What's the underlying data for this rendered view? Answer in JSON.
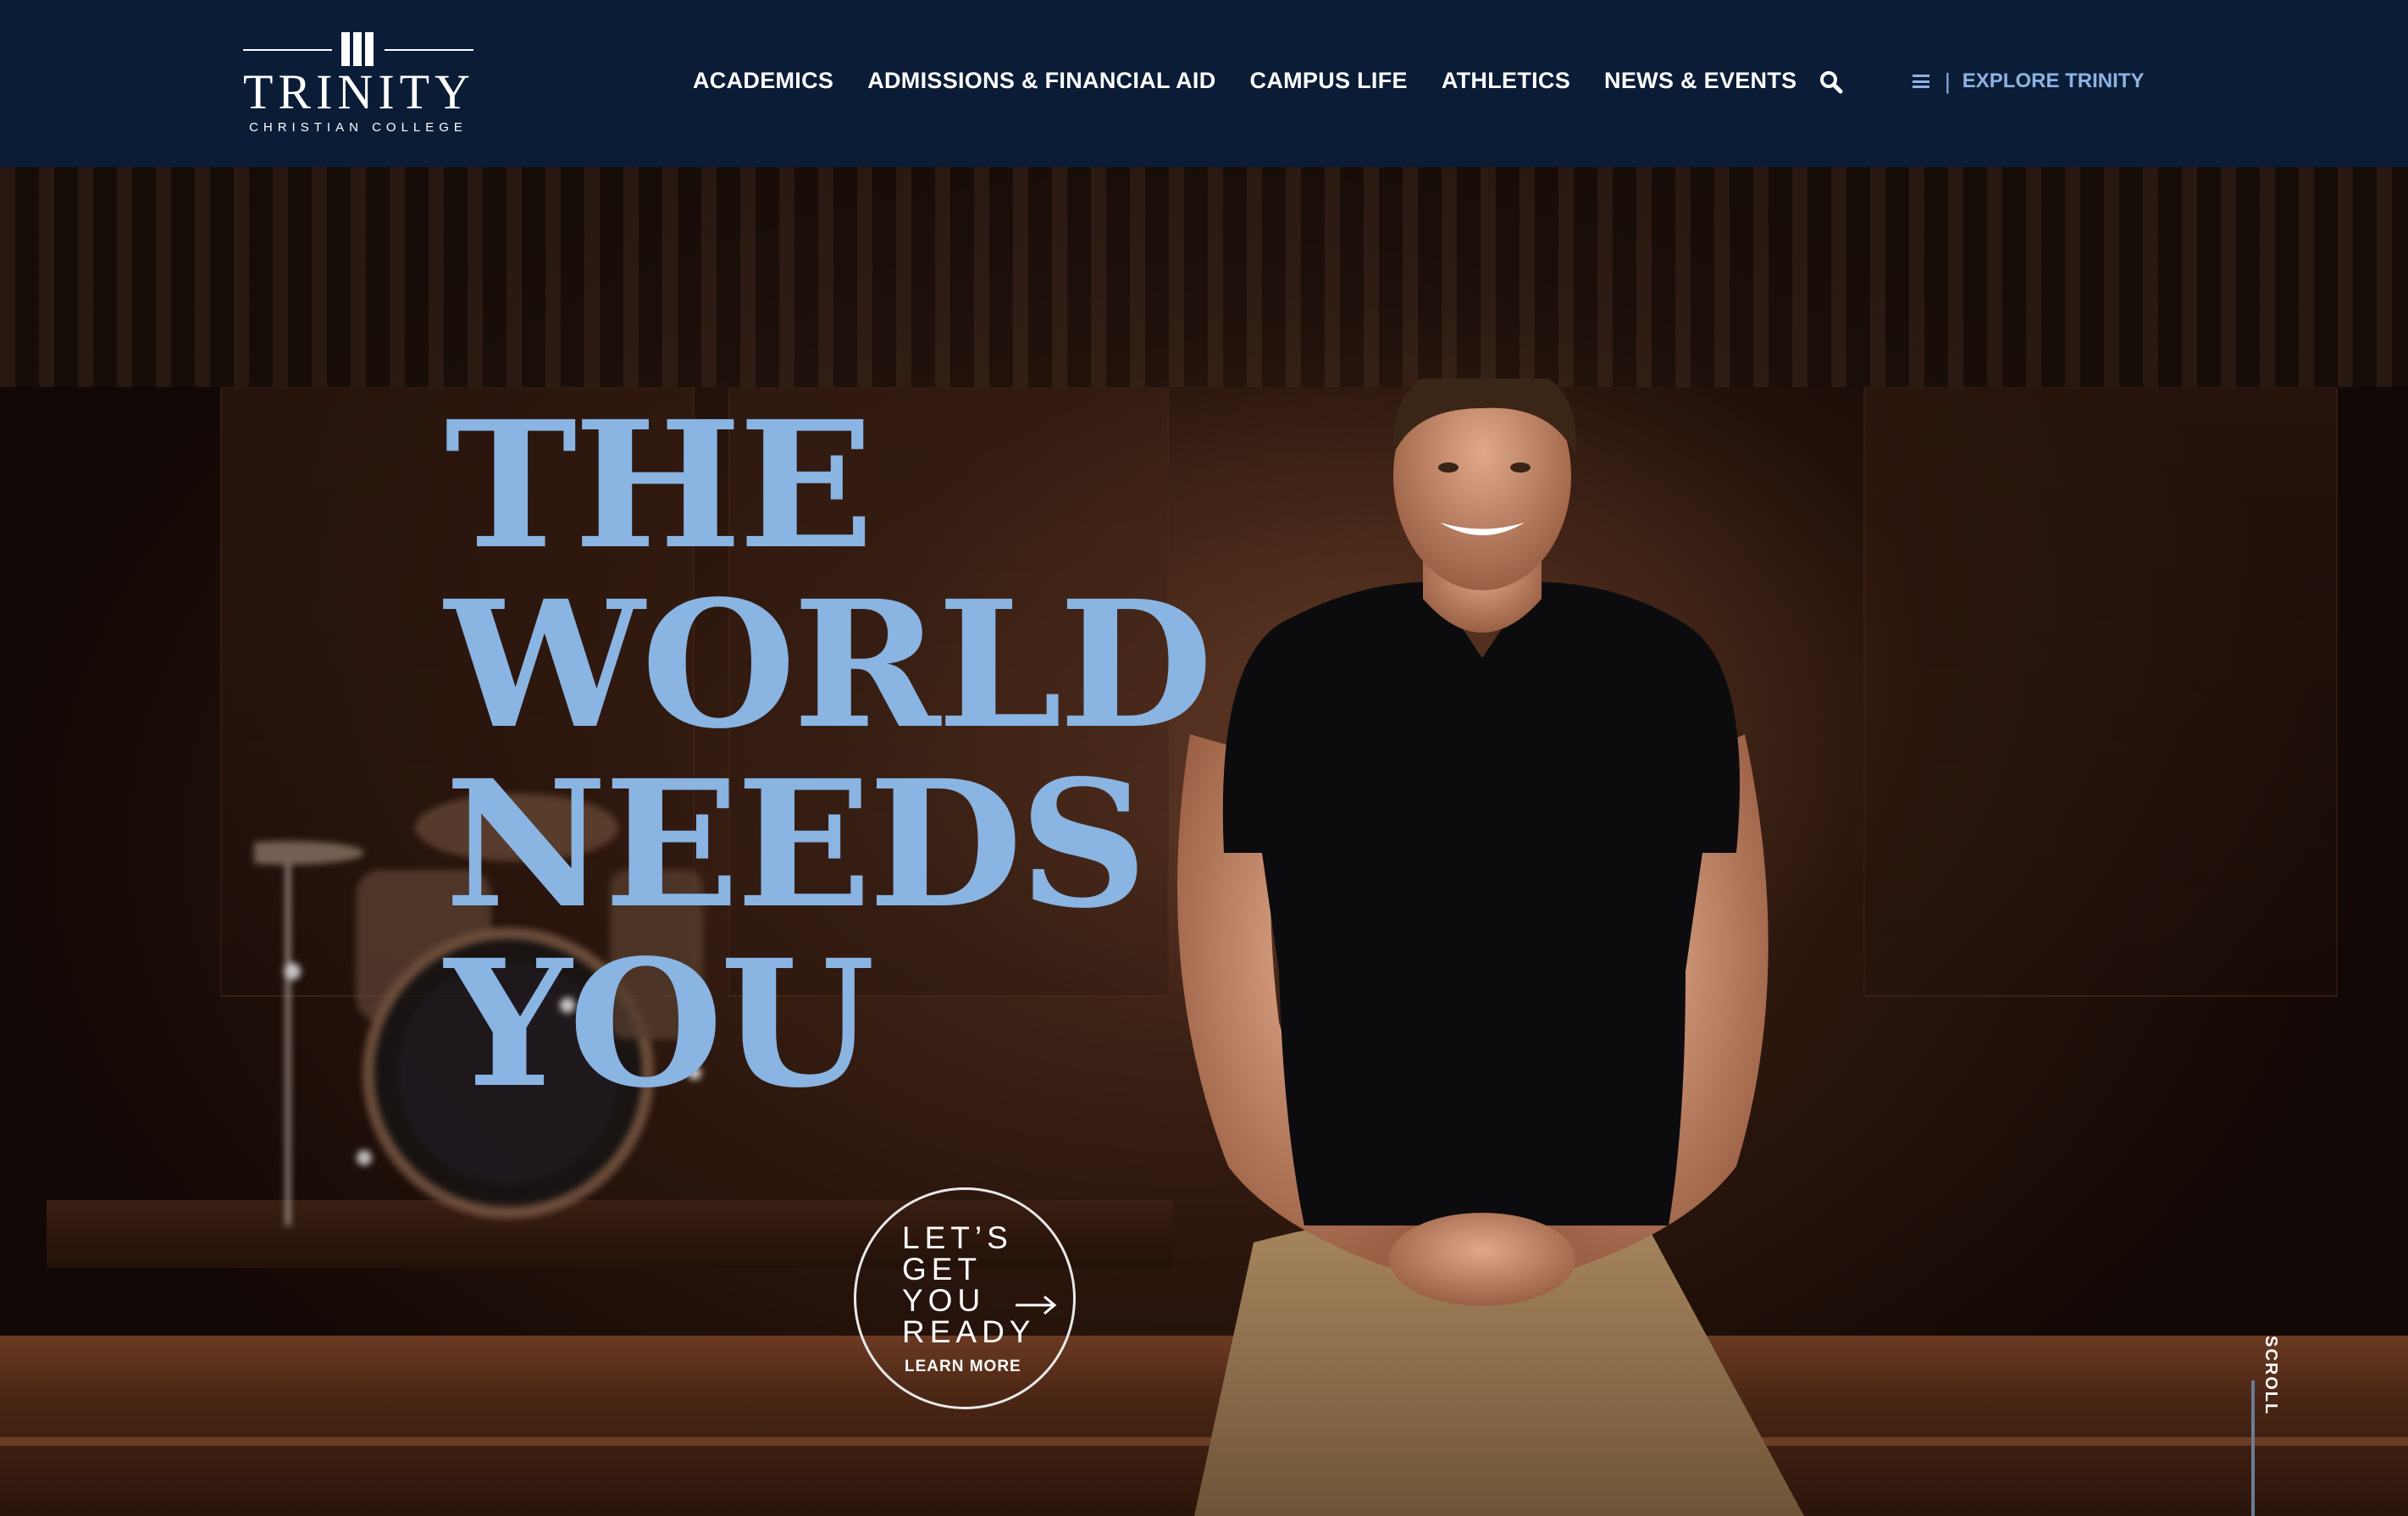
{
  "header": {
    "logo": {
      "name": "TRINITY",
      "subtitle": "CHRISTIAN COLLEGE"
    },
    "nav": [
      {
        "label": "ACADEMICS"
      },
      {
        "label": "ADMISSIONS & FINANCIAL AID"
      },
      {
        "label": "CAMPUS LIFE"
      },
      {
        "label": "ATHLETICS"
      },
      {
        "label": "NEWS & EVENTS"
      }
    ],
    "search_icon": "search-icon",
    "explore": {
      "separator": "|",
      "label": "EXPLORE TRINITY",
      "icon": "hamburger-icon"
    }
  },
  "hero": {
    "headline": [
      "THE",
      "WORLD",
      "NEEDS",
      "YOU"
    ],
    "cta": {
      "lines": [
        "LET’S",
        "GET",
        "YOU",
        "READY"
      ],
      "learn_more": "LEARN MORE",
      "icon": "arrow-right-icon"
    },
    "scroll": "SCROLL"
  },
  "colors": {
    "header_bg": "#0b1c37",
    "accent": "#8ab4e2",
    "explore": "#8db3e2",
    "text": "#ffffff"
  }
}
